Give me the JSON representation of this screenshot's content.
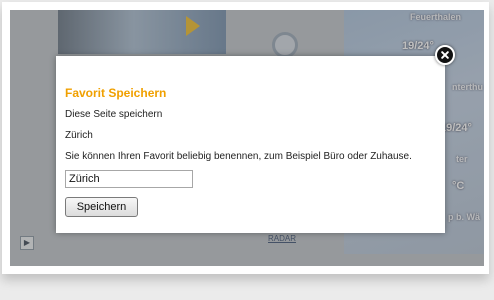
{
  "background": {
    "cities": [
      "Feuerthalen",
      "nterthu",
      "ter",
      "p b. Wä"
    ],
    "temps": [
      "19/24°",
      "19/24°",
      "19/24°",
      "°C"
    ],
    "radar_link": "RADAR"
  },
  "dialog": {
    "title": "Favorit Speichern",
    "subtitle": "Diese Seite speichern",
    "page_name": "Zürich",
    "hint": "Sie können Ihren Favorit beliebig benennen, zum Beispiel Büro oder Zuhause.",
    "input": {
      "value": "Zürich"
    },
    "save_label": "Speichern"
  },
  "colors": {
    "title_accent": "#f0a000",
    "overlay": "rgba(0,0,0,0.25)"
  },
  "icons": {
    "close": "close-icon",
    "play": "play-icon",
    "weather": "sun-icon"
  }
}
